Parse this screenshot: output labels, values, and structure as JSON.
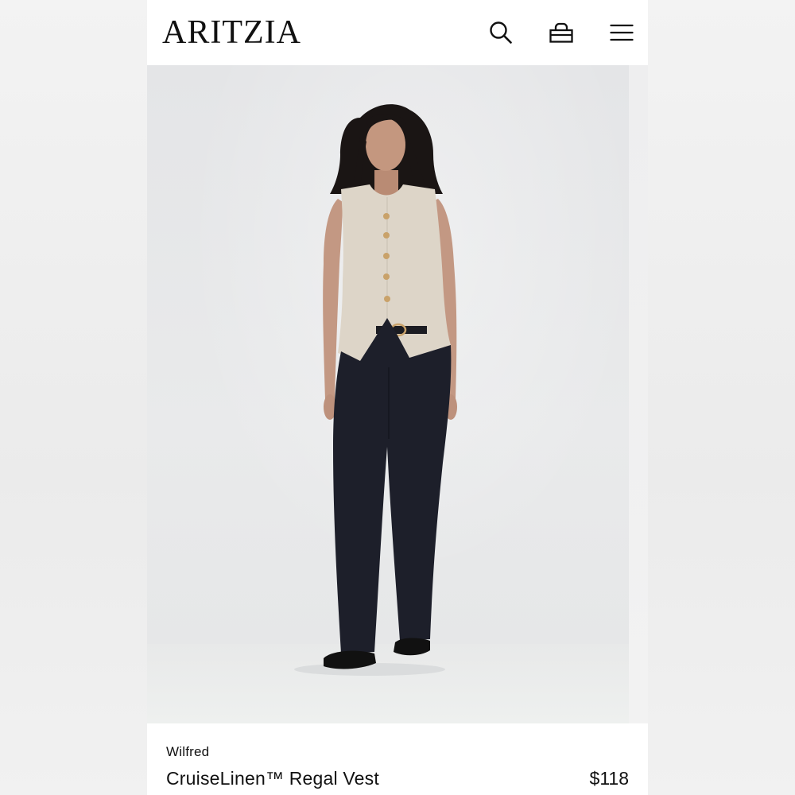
{
  "header": {
    "logo": "ARITZIA",
    "icons": {
      "search": "search-icon",
      "bag": "shopping-bag-icon",
      "menu": "hamburger-menu-icon"
    }
  },
  "product": {
    "brand": "Wilfred",
    "name": "CruiseLinen™ Regal Vest",
    "price": "$118",
    "image": "product-photo"
  },
  "colors": {
    "text": "#111111",
    "background": "#ffffff",
    "page_background": "#ececec"
  }
}
